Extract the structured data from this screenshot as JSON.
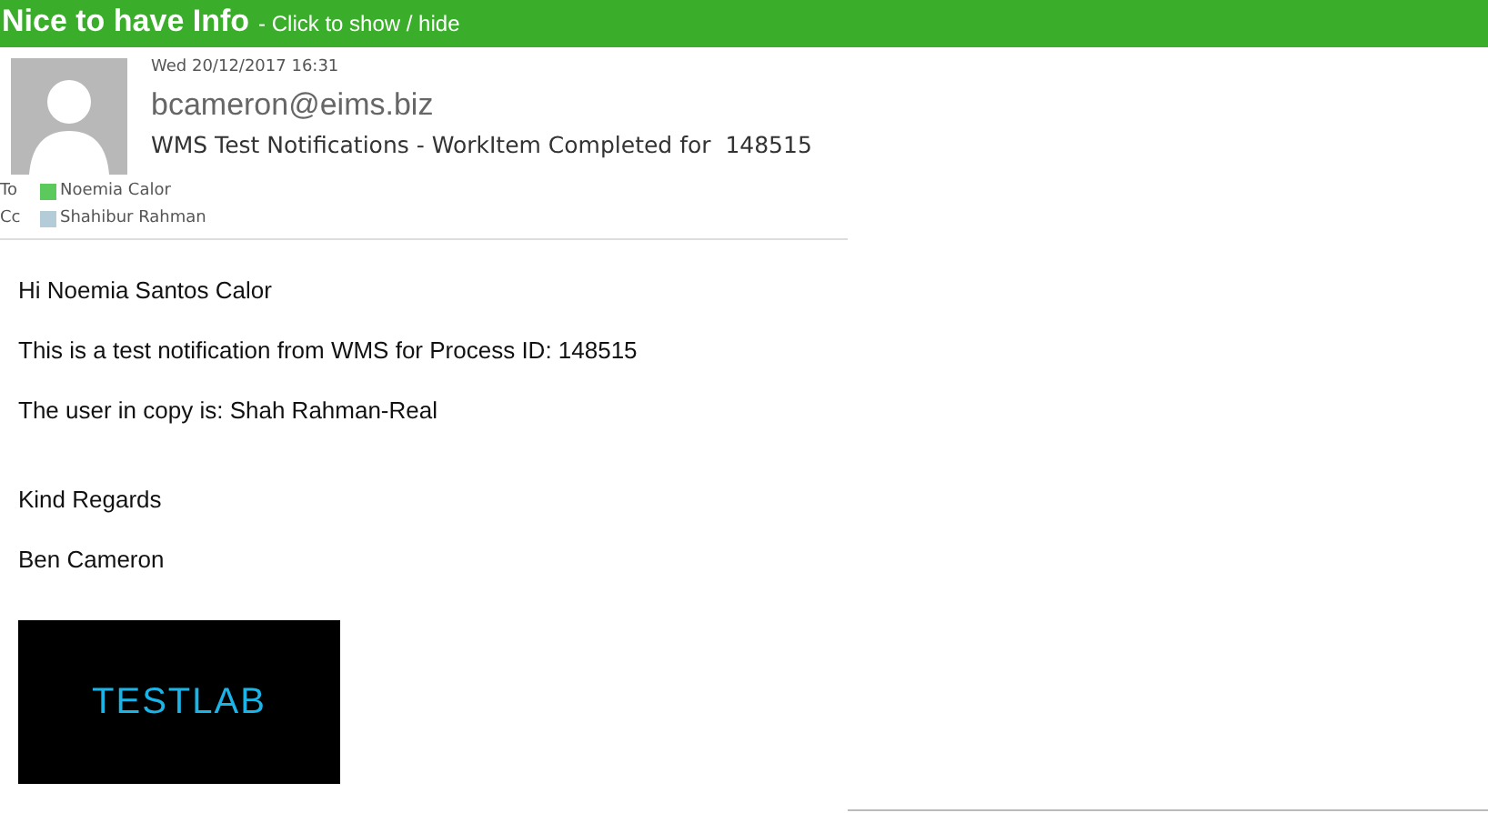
{
  "banner": {
    "title": "Nice to have Info",
    "hint": "- Click to show / hide"
  },
  "email": {
    "date": "Wed 20/12/2017 16:31",
    "sender": "bcameron@eims.biz",
    "subject": "WMS Test Notifications - WorkItem Completed for  148515",
    "recipients": [
      {
        "field": "To",
        "name": "Noemia Calor",
        "color": "#5cc95c"
      },
      {
        "field": "Cc",
        "name": "Shahibur Rahman",
        "color": "#b4ccd8"
      }
    ]
  },
  "body": {
    "paragraphs": [
      "Hi Noemia Santos Calor",
      "This is a test notification from WMS for Process ID: 148515",
      "The user in copy is: Shah Rahman-Real"
    ],
    "closing": [
      "Kind Regards",
      "Ben Cameron"
    ],
    "logo": "TESTLAB"
  }
}
